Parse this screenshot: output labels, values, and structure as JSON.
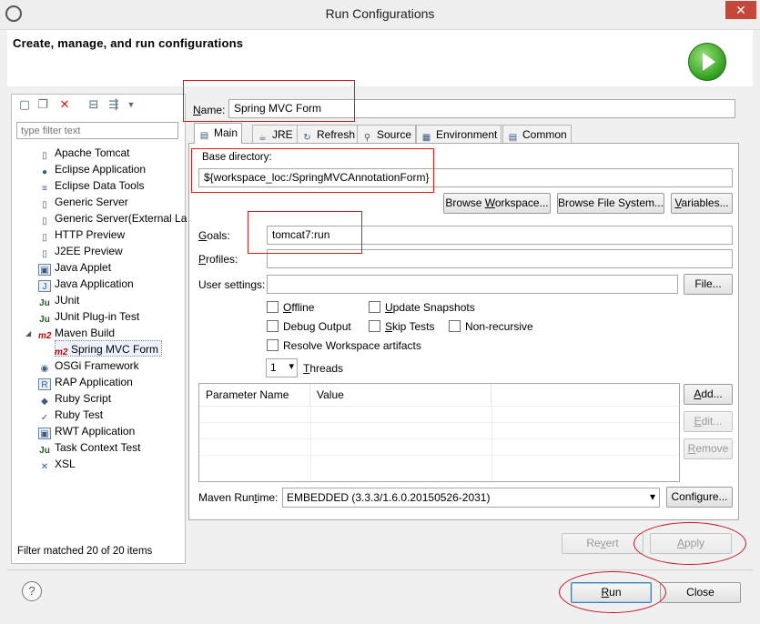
{
  "window": {
    "title": "Run Configurations",
    "close_glyph": "✕"
  },
  "header": {
    "text": "Create, manage, and run configurations"
  },
  "left": {
    "toolbar_icons": [
      "new-config-icon",
      "duplicate-icon",
      "delete-icon",
      "collapse-all-icon",
      "filter-icon",
      "view-menu-icon"
    ],
    "filter_placeholder": "type filter text",
    "tree": [
      {
        "label": "Apache Tomcat",
        "icon": "tomcat-icon",
        "glyph": "▯"
      },
      {
        "label": "Eclipse Application",
        "icon": "eclipse-icon",
        "glyph": "●"
      },
      {
        "label": "Eclipse Data Tools",
        "icon": "database-icon",
        "glyph": "≡"
      },
      {
        "label": "Generic Server",
        "icon": "server-icon",
        "glyph": "▯"
      },
      {
        "label": "Generic Server(External La",
        "icon": "server-icon",
        "glyph": "▯"
      },
      {
        "label": "HTTP Preview",
        "icon": "server-icon",
        "glyph": "▯"
      },
      {
        "label": "J2EE Preview",
        "icon": "server-icon",
        "glyph": "▯"
      },
      {
        "label": "Java Applet",
        "icon": "applet-icon",
        "glyph": "▣"
      },
      {
        "label": "Java Application",
        "icon": "java-app-icon",
        "glyph": "J"
      },
      {
        "label": "JUnit",
        "icon": "junit-icon",
        "glyph": "Ju"
      },
      {
        "label": "JUnit Plug-in Test",
        "icon": "junit-plugin-icon",
        "glyph": "Ju"
      },
      {
        "label": "Maven Build",
        "icon": "maven-icon",
        "glyph": "m2",
        "expanded": true
      },
      {
        "label": "Spring MVC Form",
        "icon": "maven-icon",
        "glyph": "m2",
        "child": true,
        "selected": true
      },
      {
        "label": "OSGi Framework",
        "icon": "osgi-icon",
        "glyph": "◉"
      },
      {
        "label": "RAP Application",
        "icon": "rap-icon",
        "glyph": "R"
      },
      {
        "label": "Ruby Script",
        "icon": "ruby-icon",
        "glyph": "◆"
      },
      {
        "label": "Ruby Test",
        "icon": "ruby-test-icon",
        "glyph": "✓"
      },
      {
        "label": "RWT Application",
        "icon": "rwt-icon",
        "glyph": "▣"
      },
      {
        "label": "Task Context Test",
        "icon": "task-test-icon",
        "glyph": "Ju"
      },
      {
        "label": "XSL",
        "icon": "xsl-icon",
        "glyph": "✕"
      }
    ],
    "status": "Filter matched 20 of 20 items"
  },
  "form": {
    "name_label": "Name:",
    "name_value": "Spring MVC Form",
    "tabs": [
      {
        "label": "Main",
        "icon": "main-tab-icon",
        "glyph": "▤"
      },
      {
        "label": "JRE",
        "icon": "jre-icon",
        "glyph": "☕"
      },
      {
        "label": "Refresh",
        "icon": "refresh-icon",
        "glyph": "↻"
      },
      {
        "label": "Source",
        "icon": "source-icon",
        "glyph": "⚲"
      },
      {
        "label": "Environment",
        "icon": "environment-icon",
        "glyph": "▦"
      },
      {
        "label": "Common",
        "icon": "common-icon",
        "glyph": "▤"
      }
    ],
    "base_dir_label": "Base directory:",
    "base_dir_value": "${workspace_loc:/SpringMVCAnnotationForm}",
    "browse_workspace": "Browse Workspace...",
    "browse_fs": "Browse File System...",
    "variables": "Variables...",
    "goals_label": "Goals:",
    "goals_value": "tomcat7:run",
    "profiles_label": "Profiles:",
    "profiles_value": "",
    "user_settings_label": "User settings:",
    "user_settings_value": "",
    "file_button": "File...",
    "checkboxes": {
      "offline": "Offline",
      "update_snapshots": "Update Snapshots",
      "debug_output": "Debug Output",
      "skip_tests": "Skip Tests",
      "non_recursive": "Non-recursive",
      "resolve_workspace": "Resolve Workspace artifacts"
    },
    "threads_value": "1",
    "threads_label": "Threads",
    "param_headers": [
      "Parameter Name",
      "Value"
    ],
    "add": "Add...",
    "edit": "Edit...",
    "remove": "Remove",
    "runtime_label": "Maven Runtime:",
    "runtime_value": "EMBEDDED (3.3.3/1.6.0.20150526-2031)",
    "configure": "Configure..."
  },
  "footer": {
    "revert": "Revert",
    "apply": "Apply",
    "run": "Run",
    "close": "Close",
    "help_glyph": "?"
  }
}
